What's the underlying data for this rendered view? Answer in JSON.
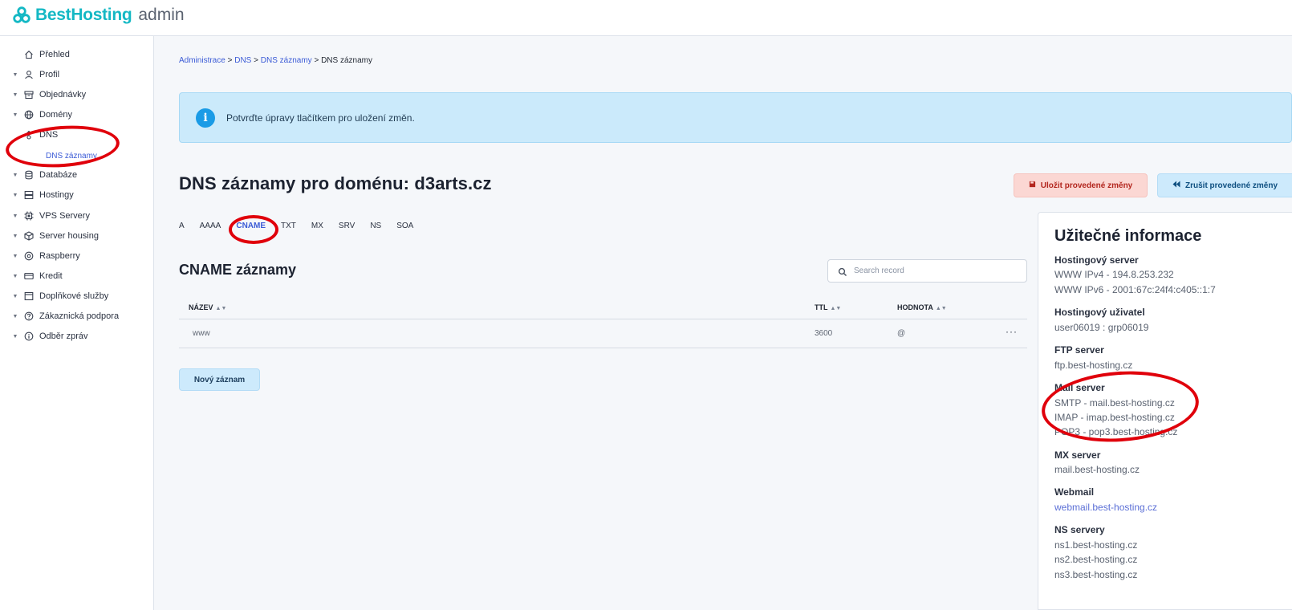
{
  "header": {
    "brand": "BestHosting",
    "suffix": "admin"
  },
  "sidebar": {
    "items": [
      {
        "label": "Přehled",
        "icon": "home-icon",
        "caret": false
      },
      {
        "label": "Profil",
        "icon": "user-icon",
        "caret": true
      },
      {
        "label": "Objednávky",
        "icon": "archive-icon",
        "caret": true
      },
      {
        "label": "Domény",
        "icon": "globe-icon",
        "caret": true
      },
      {
        "label": "DNS",
        "icon": "dns-icon",
        "caret": true
      },
      {
        "label": "Databáze",
        "icon": "database-icon",
        "caret": true
      },
      {
        "label": "Hostingy",
        "icon": "server-icon",
        "caret": true
      },
      {
        "label": "VPS Servery",
        "icon": "cpu-icon",
        "caret": true
      },
      {
        "label": "Server housing",
        "icon": "cube-icon",
        "caret": true
      },
      {
        "label": "Raspberry",
        "icon": "disc-icon",
        "caret": true
      },
      {
        "label": "Kredit",
        "icon": "card-icon",
        "caret": true
      },
      {
        "label": "Doplňkové služby",
        "icon": "cart-icon",
        "caret": true
      },
      {
        "label": "Zákaznická podpora",
        "icon": "help-icon",
        "caret": true
      },
      {
        "label": "Odběr zpráv",
        "icon": "info-icon",
        "caret": true
      }
    ],
    "dns_sub": "DNS záznamy"
  },
  "breadcrumb": {
    "c1": "Administrace",
    "c2": "DNS",
    "c3": "DNS záznamy",
    "current": "DNS záznamy",
    "sep": ">"
  },
  "alert": {
    "text": "Potvrďte úpravy tlačítkem pro uložení změn."
  },
  "page_title": "DNS záznamy pro doménu: d3arts.cz",
  "actions": {
    "save": "Uložit provedené změny",
    "cancel": "Zrušit provedené změny"
  },
  "tabs": [
    "A",
    "AAAA",
    "CNAME",
    "TXT",
    "MX",
    "SRV",
    "NS",
    "SOA"
  ],
  "active_tab": "CNAME",
  "section_title": "CNAME záznamy",
  "search": {
    "placeholder": "Search record"
  },
  "table": {
    "columns": [
      "NÁZEV",
      "TTL",
      "HODNOTA"
    ],
    "rows": [
      {
        "name": "www",
        "ttl": "3600",
        "value": "@"
      }
    ]
  },
  "new_record": "Nový záznam",
  "info": {
    "title": "Užitečné informace",
    "hosting_server_label": "Hostingový server",
    "ipv4": "WWW IPv4 - 194.8.253.232",
    "ipv6": "WWW IPv6 - 2001:67c:24f4:c405::1:7",
    "hosting_user_label": "Hostingový uživatel",
    "hosting_user": "user06019 : grp06019",
    "ftp_label": "FTP server",
    "ftp": "ftp.best-hosting.cz",
    "mail_label": "Mail server",
    "smtp": "SMTP - mail.best-hosting.cz",
    "imap": "IMAP - imap.best-hosting.cz",
    "pop3": "POP3 - pop3.best-hosting.cz",
    "mx_label": "MX server",
    "mx": "mail.best-hosting.cz",
    "webmail_label": "Webmail",
    "webmail": "webmail.best-hosting.cz",
    "ns_label": "NS servery",
    "ns1": "ns1.best-hosting.cz",
    "ns2": "ns2.best-hosting.cz",
    "ns3": "ns3.best-hosting.cz"
  },
  "colors": {
    "brand": "#14b8c4",
    "link": "#3b5bd6",
    "annotation": "#e0000b"
  }
}
